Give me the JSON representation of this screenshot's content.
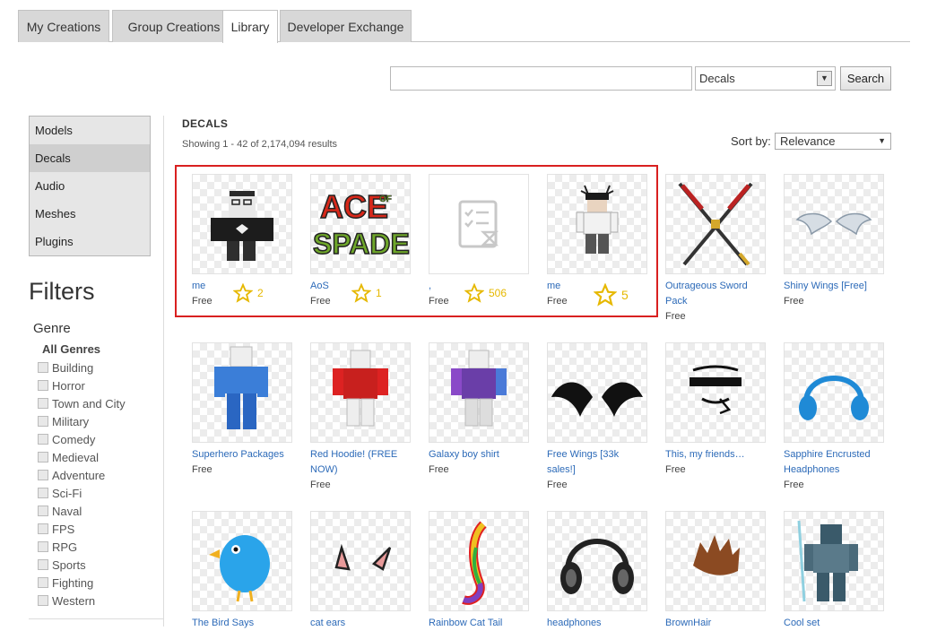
{
  "tabs": [
    "My Creations",
    "Group Creations",
    "Library",
    "Developer Exchange"
  ],
  "search": {
    "value": "",
    "category": "Decals",
    "button": "Search"
  },
  "categories": [
    "Models",
    "Decals",
    "Audio",
    "Meshes",
    "Plugins"
  ],
  "filters": {
    "title": "Filters",
    "genre_title": "Genre",
    "all_genres": "All Genres",
    "genres": [
      "Building",
      "Horror",
      "Town and City",
      "Military",
      "Comedy",
      "Medieval",
      "Adventure",
      "Sci-Fi",
      "Naval",
      "FPS",
      "RPG",
      "Sports",
      "Fighting",
      "Western"
    ]
  },
  "results": {
    "title": "DECALS",
    "count": "Showing 1 - 42 of 2,174,094 results",
    "sort_label": "Sort by:",
    "sort_value": "Relevance"
  },
  "colors": {
    "highlight": "#d92020",
    "link": "#2c6ab8",
    "star": "#e6b800"
  },
  "items": [
    {
      "name": "me",
      "price": "Free",
      "rating": "2",
      "icon": "avatar-black-suit"
    },
    {
      "name": "AoS",
      "price": "Free",
      "rating": "1",
      "icon": "ace-of-spades-logo"
    },
    {
      "name": ",",
      "price": "Free",
      "rating": "506",
      "icon": "pending-review-placeholder"
    },
    {
      "name": "me",
      "price": "Free",
      "rating": "5",
      "icon": "avatar-antlers"
    },
    {
      "name": "Outrageous Sword Pack",
      "price": "Free",
      "icon": "crossed-swords"
    },
    {
      "name": "Shiny Wings [Free]",
      "price": "Free",
      "icon": "white-wings"
    },
    {
      "name": "Superhero Packages",
      "price": "Free",
      "icon": "blue-checkered-avatar"
    },
    {
      "name": "Red Hoodie! (FREE NOW)",
      "price": "Free",
      "icon": "red-hoodie-avatar"
    },
    {
      "name": "Galaxy boy shirt",
      "price": "Free",
      "icon": "galaxy-shirt-avatar"
    },
    {
      "name": "Free Wings [33k sales!]",
      "price": "Free",
      "icon": "black-wings"
    },
    {
      "name": "This, my friends…",
      "price": "Free",
      "icon": "meme-face"
    },
    {
      "name": "Sapphire Encrusted Headphones",
      "price": "Free",
      "icon": "blue-headphones"
    },
    {
      "name": "The Bird Says",
      "price": "",
      "icon": "blue-bird"
    },
    {
      "name": "cat ears",
      "price": "",
      "icon": "cat-ears"
    },
    {
      "name": "Rainbow Cat Tail",
      "price": "",
      "icon": "rainbow-tail"
    },
    {
      "name": "headphones",
      "price": "",
      "icon": "black-headphones"
    },
    {
      "name": "BrownHair",
      "price": "",
      "icon": "brown-hair"
    },
    {
      "name": "Cool set",
      "price": "",
      "icon": "armor-set"
    }
  ]
}
